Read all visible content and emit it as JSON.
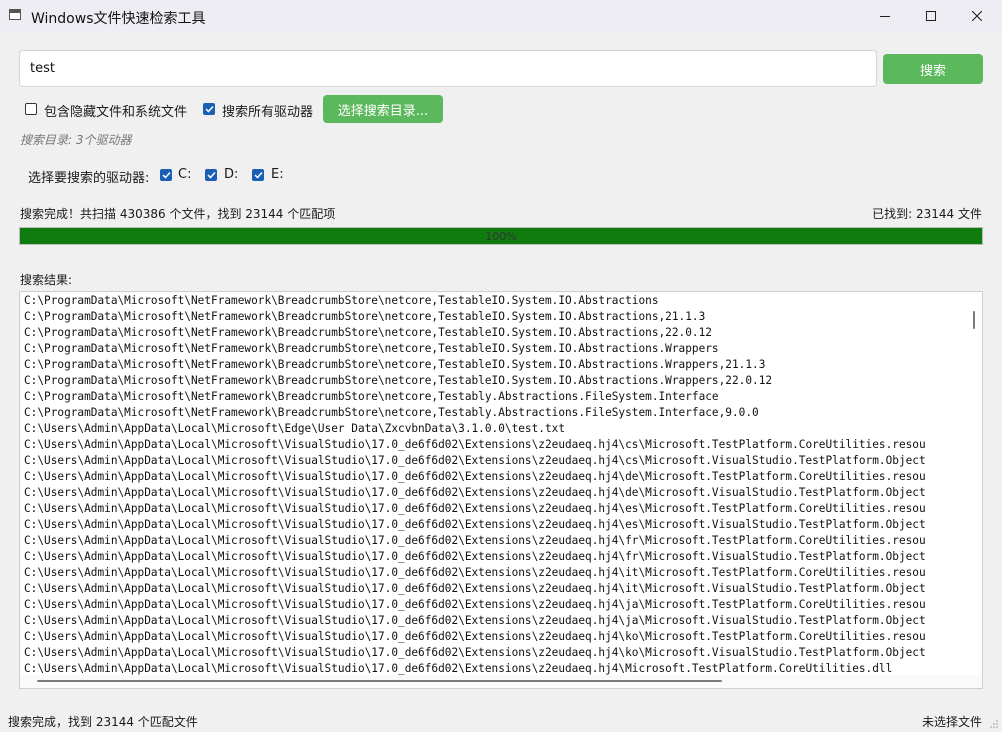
{
  "window": {
    "title": "Windows文件快速检索工具",
    "icons": [
      "app-window-icon",
      "minimize-icon",
      "maximize-icon",
      "close-icon"
    ]
  },
  "search": {
    "value": "test",
    "button_label": "搜索"
  },
  "options": {
    "hidden_files": {
      "label": "包含隐藏文件和系统文件",
      "checked": false
    },
    "all_drives": {
      "label": "搜索所有驱动器",
      "checked": true
    },
    "choose_dir_label": "选择搜索目录...",
    "dir_info": "搜索目录: 3个驱动器"
  },
  "drives": {
    "label": "选择要搜索的驱动器:",
    "items": [
      {
        "label": "C:",
        "checked": true
      },
      {
        "label": "D:",
        "checked": true
      },
      {
        "label": "E:",
        "checked": true
      }
    ]
  },
  "progress": {
    "status": "搜索完成！共扫描 430386 个文件，找到 23144 个匹配项",
    "found": "已找到: 23144 文件",
    "percent_text": "100%",
    "fraction": 1.0
  },
  "results": {
    "label": "搜索结果:",
    "lines": [
      "C:\\ProgramData\\Microsoft\\NetFramework\\BreadcrumbStore\\netcore,TestableIO.System.IO.Abstractions",
      "C:\\ProgramData\\Microsoft\\NetFramework\\BreadcrumbStore\\netcore,TestableIO.System.IO.Abstractions,21.1.3",
      "C:\\ProgramData\\Microsoft\\NetFramework\\BreadcrumbStore\\netcore,TestableIO.System.IO.Abstractions,22.0.12",
      "C:\\ProgramData\\Microsoft\\NetFramework\\BreadcrumbStore\\netcore,TestableIO.System.IO.Abstractions.Wrappers",
      "C:\\ProgramData\\Microsoft\\NetFramework\\BreadcrumbStore\\netcore,TestableIO.System.IO.Abstractions.Wrappers,21.1.3",
      "C:\\ProgramData\\Microsoft\\NetFramework\\BreadcrumbStore\\netcore,TestableIO.System.IO.Abstractions.Wrappers,22.0.12",
      "C:\\ProgramData\\Microsoft\\NetFramework\\BreadcrumbStore\\netcore,Testably.Abstractions.FileSystem.Interface",
      "C:\\ProgramData\\Microsoft\\NetFramework\\BreadcrumbStore\\netcore,Testably.Abstractions.FileSystem.Interface,9.0.0",
      "C:\\Users\\Admin\\AppData\\Local\\Microsoft\\Edge\\User Data\\ZxcvbnData\\3.1.0.0\\test.txt",
      "C:\\Users\\Admin\\AppData\\Local\\Microsoft\\VisualStudio\\17.0_de6f6d02\\Extensions\\z2eudaeq.hj4\\cs\\Microsoft.TestPlatform.CoreUtilities.resou",
      "C:\\Users\\Admin\\AppData\\Local\\Microsoft\\VisualStudio\\17.0_de6f6d02\\Extensions\\z2eudaeq.hj4\\cs\\Microsoft.VisualStudio.TestPlatform.Object",
      "C:\\Users\\Admin\\AppData\\Local\\Microsoft\\VisualStudio\\17.0_de6f6d02\\Extensions\\z2eudaeq.hj4\\de\\Microsoft.TestPlatform.CoreUtilities.resou",
      "C:\\Users\\Admin\\AppData\\Local\\Microsoft\\VisualStudio\\17.0_de6f6d02\\Extensions\\z2eudaeq.hj4\\de\\Microsoft.VisualStudio.TestPlatform.Object",
      "C:\\Users\\Admin\\AppData\\Local\\Microsoft\\VisualStudio\\17.0_de6f6d02\\Extensions\\z2eudaeq.hj4\\es\\Microsoft.TestPlatform.CoreUtilities.resou",
      "C:\\Users\\Admin\\AppData\\Local\\Microsoft\\VisualStudio\\17.0_de6f6d02\\Extensions\\z2eudaeq.hj4\\es\\Microsoft.VisualStudio.TestPlatform.Object",
      "C:\\Users\\Admin\\AppData\\Local\\Microsoft\\VisualStudio\\17.0_de6f6d02\\Extensions\\z2eudaeq.hj4\\fr\\Microsoft.TestPlatform.CoreUtilities.resou",
      "C:\\Users\\Admin\\AppData\\Local\\Microsoft\\VisualStudio\\17.0_de6f6d02\\Extensions\\z2eudaeq.hj4\\fr\\Microsoft.VisualStudio.TestPlatform.Object",
      "C:\\Users\\Admin\\AppData\\Local\\Microsoft\\VisualStudio\\17.0_de6f6d02\\Extensions\\z2eudaeq.hj4\\it\\Microsoft.TestPlatform.CoreUtilities.resou",
      "C:\\Users\\Admin\\AppData\\Local\\Microsoft\\VisualStudio\\17.0_de6f6d02\\Extensions\\z2eudaeq.hj4\\it\\Microsoft.VisualStudio.TestPlatform.Object",
      "C:\\Users\\Admin\\AppData\\Local\\Microsoft\\VisualStudio\\17.0_de6f6d02\\Extensions\\z2eudaeq.hj4\\ja\\Microsoft.TestPlatform.CoreUtilities.resou",
      "C:\\Users\\Admin\\AppData\\Local\\Microsoft\\VisualStudio\\17.0_de6f6d02\\Extensions\\z2eudaeq.hj4\\ja\\Microsoft.VisualStudio.TestPlatform.Object",
      "C:\\Users\\Admin\\AppData\\Local\\Microsoft\\VisualStudio\\17.0_de6f6d02\\Extensions\\z2eudaeq.hj4\\ko\\Microsoft.TestPlatform.CoreUtilities.resou",
      "C:\\Users\\Admin\\AppData\\Local\\Microsoft\\VisualStudio\\17.0_de6f6d02\\Extensions\\z2eudaeq.hj4\\ko\\Microsoft.VisualStudio.TestPlatform.Object",
      "C:\\Users\\Admin\\AppData\\Local\\Microsoft\\VisualStudio\\17.0_de6f6d02\\Extensions\\z2eudaeq.hj4\\Microsoft.TestPlatform.CoreUtilities.dll"
    ]
  },
  "statusbar": {
    "left": "搜索完成，找到 23144 个匹配文件",
    "right": "未选择文件"
  },
  "colors": {
    "accent_green": "#5cb85c",
    "progress_green": "#107c10",
    "checkbox_blue": "#1a5fb4"
  }
}
